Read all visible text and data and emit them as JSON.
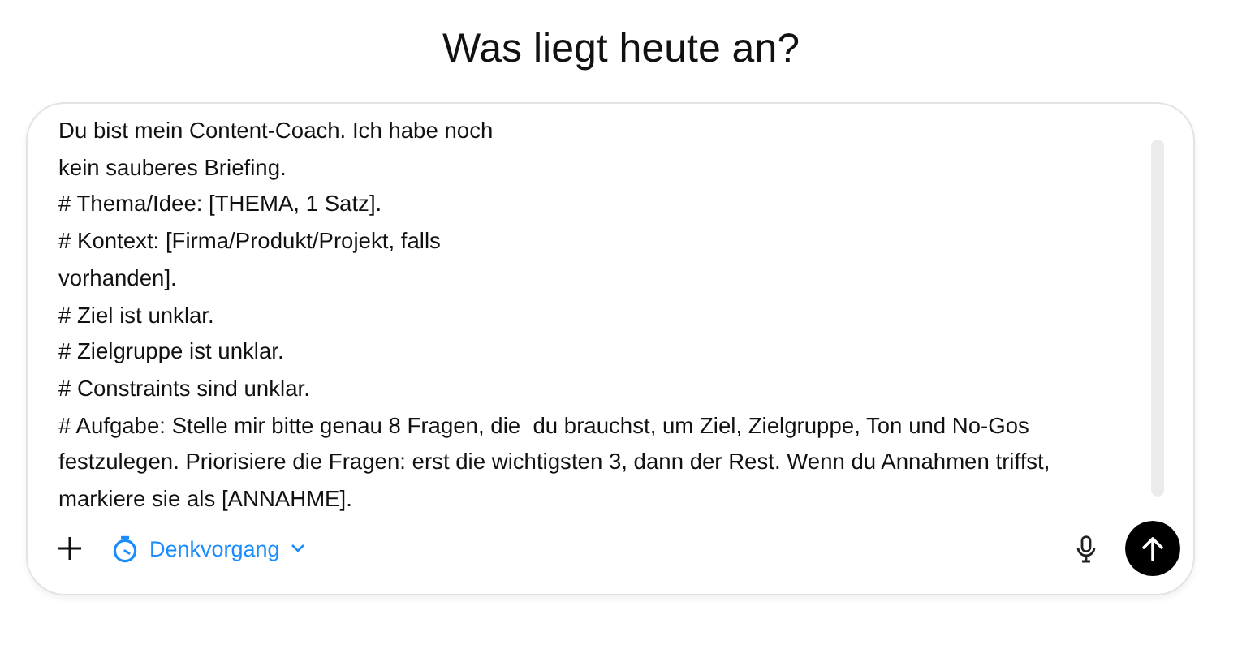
{
  "heading": "Was liegt heute an?",
  "composer": {
    "value": "Du bist mein Content-Coach. Ich habe noch\nkein sauberes Briefing.\n# Thema/Idee: [THEMA, 1 Satz].\n# Kontext: [Firma/Produkt/Projekt, falls\nvorhanden].\n# Ziel ist unklar.\n# Zielgruppe ist unklar.\n# Constraints sind unklar.\n# Aufgabe: Stelle mir bitte genau 8 Fragen, die  du brauchst, um Ziel, Zielgruppe, Ton und No-Gos\nfestzulegen. Priorisiere die Fragen: erst die wichtigsten 3, dann der Rest. Wenn du Annahmen triffst,\nmarkiere sie als [ANNAHME].",
    "mode": {
      "label": "Denkvorgang"
    }
  }
}
